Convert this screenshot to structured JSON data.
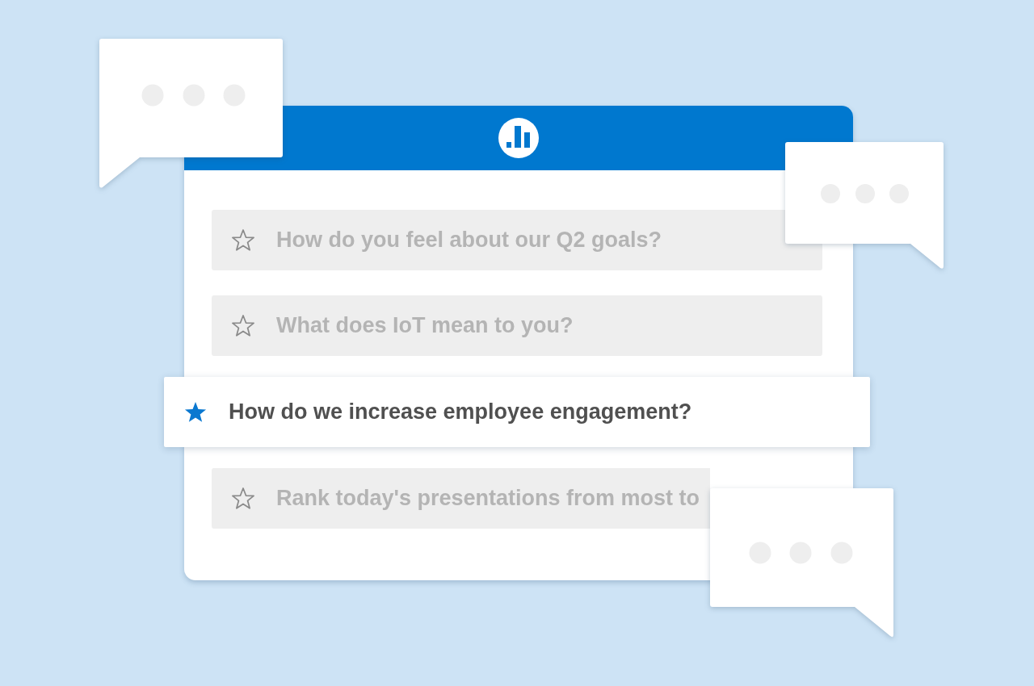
{
  "questions": [
    {
      "text": "How do you feel about our Q2 goals?",
      "selected": false
    },
    {
      "text": "What does IoT mean to you?",
      "selected": false
    },
    {
      "text": "How do we increase employee engagement?",
      "selected": true
    },
    {
      "text": "Rank today's presentations from most to",
      "selected": false
    }
  ]
}
